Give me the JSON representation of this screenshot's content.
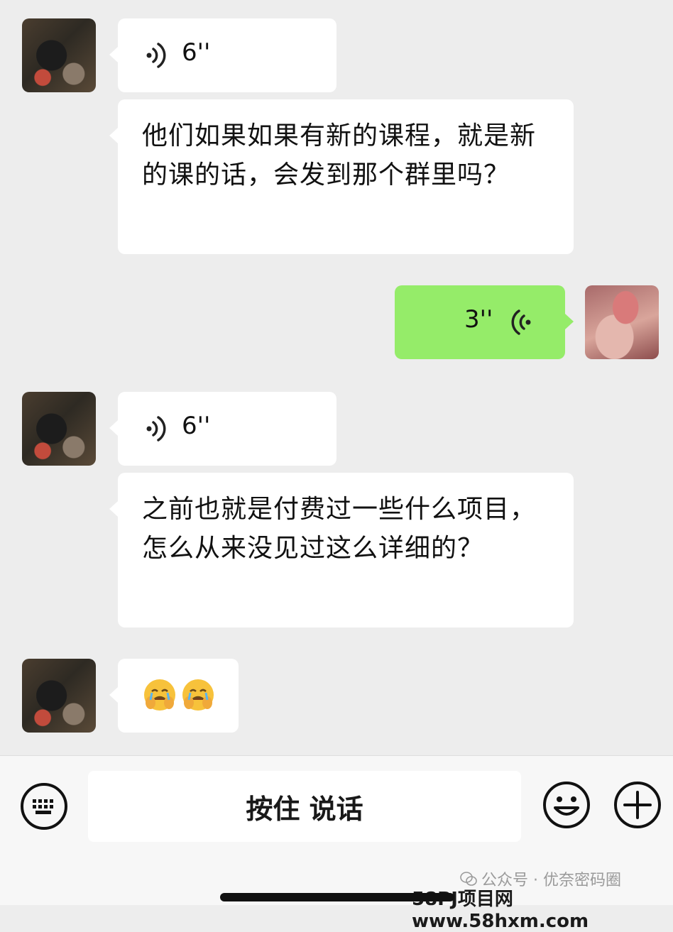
{
  "messages": [
    {
      "side": "left",
      "kind": "voice",
      "duration": "6''"
    },
    {
      "side": "left",
      "kind": "text",
      "text": "他们如果如果有新的课程，就是新的课的话，会发到那个群里吗？"
    },
    {
      "side": "right",
      "kind": "voice",
      "duration": "3''"
    },
    {
      "side": "left",
      "kind": "voice",
      "duration": "6''"
    },
    {
      "side": "left",
      "kind": "text",
      "text": "之前也就是付费过一些什么项目，怎么从来没见过这么详细的？"
    },
    {
      "side": "left",
      "kind": "emoji",
      "emojis": [
        "face-palm-crying-emoji",
        "face-palm-crying-emoji"
      ]
    }
  ],
  "input_bar": {
    "hold_to_talk_label": "按住 说话",
    "keyboard_icon": "keyboard-icon",
    "emoji_icon": "smiley-icon",
    "plus_icon": "plus-icon"
  },
  "watermark": {
    "line1": "公众号 · 优奈密码圈",
    "line2": "58PJ项目网www.58hxm.com"
  },
  "colors": {
    "background": "#ededed",
    "incoming_bubble": "#ffffff",
    "outgoing_bubble": "#95ec69"
  }
}
